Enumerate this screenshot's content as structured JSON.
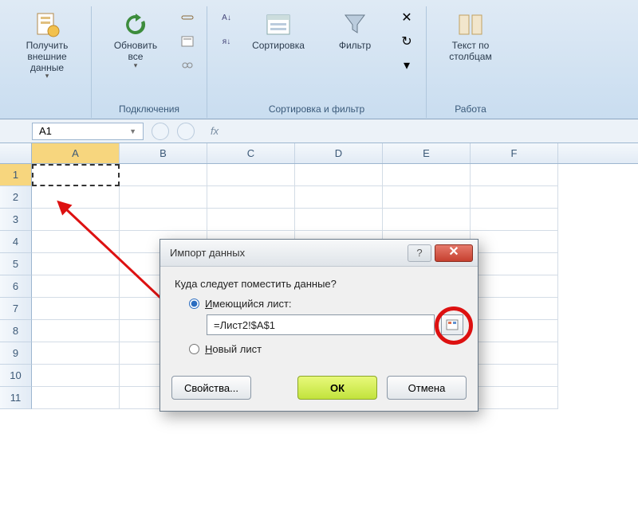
{
  "ribbon": {
    "groups": {
      "external": {
        "button_label": "Получить\nвнешние данные",
        "group_label": ""
      },
      "connections": {
        "refresh_label": "Обновить\nвсе",
        "group_label": "Подключения"
      },
      "sortfilter": {
        "sort_label": "Сортировка",
        "filter_label": "Фильтр",
        "group_label": "Сортировка и фильтр"
      },
      "datatools": {
        "ttc_label": "Текст по\nстолбцам",
        "group_label": "Работа"
      }
    }
  },
  "namebox": {
    "value": "A1"
  },
  "formula": {
    "fx": "fx"
  },
  "columns": [
    "A",
    "B",
    "C",
    "D",
    "E",
    "F"
  ],
  "rows": [
    "1",
    "2",
    "3",
    "4",
    "5",
    "6",
    "7",
    "8",
    "9",
    "10",
    "11"
  ],
  "dialog": {
    "title": "Импорт данных",
    "prompt": "Куда следует поместить данные?",
    "radio_existing": "Имеющийся лист:",
    "radio_existing_key": "И",
    "ref_value": "=Лист2!$A$1",
    "radio_new": "Новый лист",
    "radio_new_key": "Н",
    "btn_props": "Свойства...",
    "btn_ok": "ОК",
    "btn_cancel": "Отмена"
  }
}
